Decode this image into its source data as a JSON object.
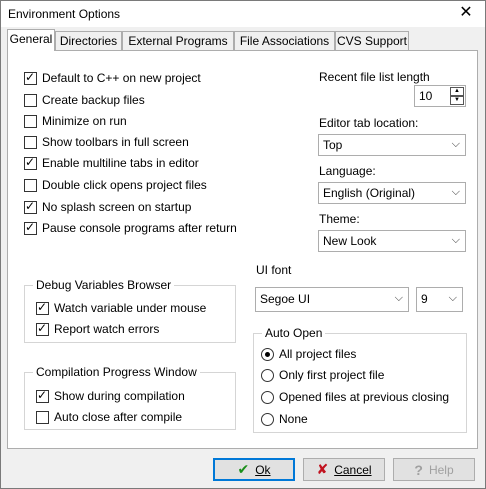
{
  "window": {
    "title": "Environment Options"
  },
  "tabs": [
    {
      "label": "General",
      "active": true
    },
    {
      "label": "Directories",
      "active": false
    },
    {
      "label": "External Programs",
      "active": false
    },
    {
      "label": "File Associations",
      "active": false
    },
    {
      "label": "CVS Support",
      "active": false
    }
  ],
  "general": {
    "options": [
      {
        "label": "Default to C++ on new project",
        "checked": true
      },
      {
        "label": "Create backup files",
        "checked": false
      },
      {
        "label": "Minimize on run",
        "checked": false
      },
      {
        "label": "Show toolbars in full screen",
        "checked": false
      },
      {
        "label": "Enable multiline tabs in editor",
        "checked": true
      },
      {
        "label": "Double click opens project files",
        "checked": false
      },
      {
        "label": "No splash screen on startup",
        "checked": true
      },
      {
        "label": "Pause console programs after return",
        "checked": true
      }
    ],
    "recent_file_label": "Recent file list length",
    "recent_file_value": "10",
    "editor_tab_label": "Editor tab location:",
    "editor_tab_value": "Top",
    "language_label": "Language:",
    "language_value": "English (Original)",
    "theme_label": "Theme:",
    "theme_value": "New Look",
    "debug_group": {
      "title": "Debug Variables Browser",
      "options": [
        {
          "label": "Watch variable under mouse",
          "checked": true
        },
        {
          "label": "Report watch errors",
          "checked": true
        }
      ]
    },
    "ui_font_label": "UI font",
    "ui_font_value": "Segoe UI",
    "ui_font_size": "9",
    "compile_group": {
      "title": "Compilation Progress Window",
      "options": [
        {
          "label": "Show during compilation",
          "checked": true
        },
        {
          "label": "Auto close after compile",
          "checked": false
        }
      ]
    },
    "auto_open_group": {
      "title": "Auto Open",
      "options": [
        {
          "label": "All project files",
          "checked": true
        },
        {
          "label": "Only first project file",
          "checked": false
        },
        {
          "label": "Opened files at previous closing",
          "checked": false
        },
        {
          "label": "None",
          "checked": false
        }
      ]
    }
  },
  "buttons": {
    "ok": "Ok",
    "cancel": "Cancel",
    "help": "Help"
  },
  "icons": {
    "ok": "checkmark-icon",
    "cancel": "x-icon",
    "help": "help-icon"
  }
}
